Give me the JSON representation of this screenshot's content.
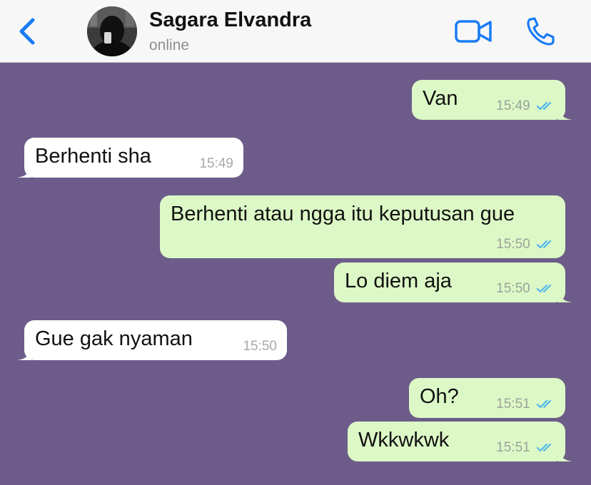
{
  "header": {
    "contact_name": "Sagara Elvandra",
    "status": "online"
  },
  "icons": {
    "back": "chevron-left-icon",
    "video": "video-camera-icon",
    "phone": "phone-icon",
    "read": "double-check-icon"
  },
  "colors": {
    "accent": "#1a7cf5",
    "chat_background": "#6d5c8a",
    "outgoing_bubble": "#dcf8c6",
    "incoming_bubble": "#ffffff",
    "read_ticks": "#4fb6ec"
  },
  "messages": [
    {
      "direction": "outgoing",
      "text": "Van",
      "time": "15:49",
      "read": true
    },
    {
      "direction": "incoming",
      "text": "Berhenti sha",
      "time": "15:49"
    },
    {
      "direction": "outgoing",
      "text": "Berhenti atau ngga itu keputusan gue",
      "time": "15:50",
      "read": true
    },
    {
      "direction": "outgoing",
      "text": "Lo diem aja",
      "time": "15:50",
      "read": true
    },
    {
      "direction": "incoming",
      "text": "Gue gak nyaman",
      "time": "15:50"
    },
    {
      "direction": "outgoing",
      "text": "Oh?",
      "time": "15:51",
      "read": true
    },
    {
      "direction": "outgoing",
      "text": "Wkkwkwk",
      "time": "15:51",
      "read": true
    }
  ]
}
